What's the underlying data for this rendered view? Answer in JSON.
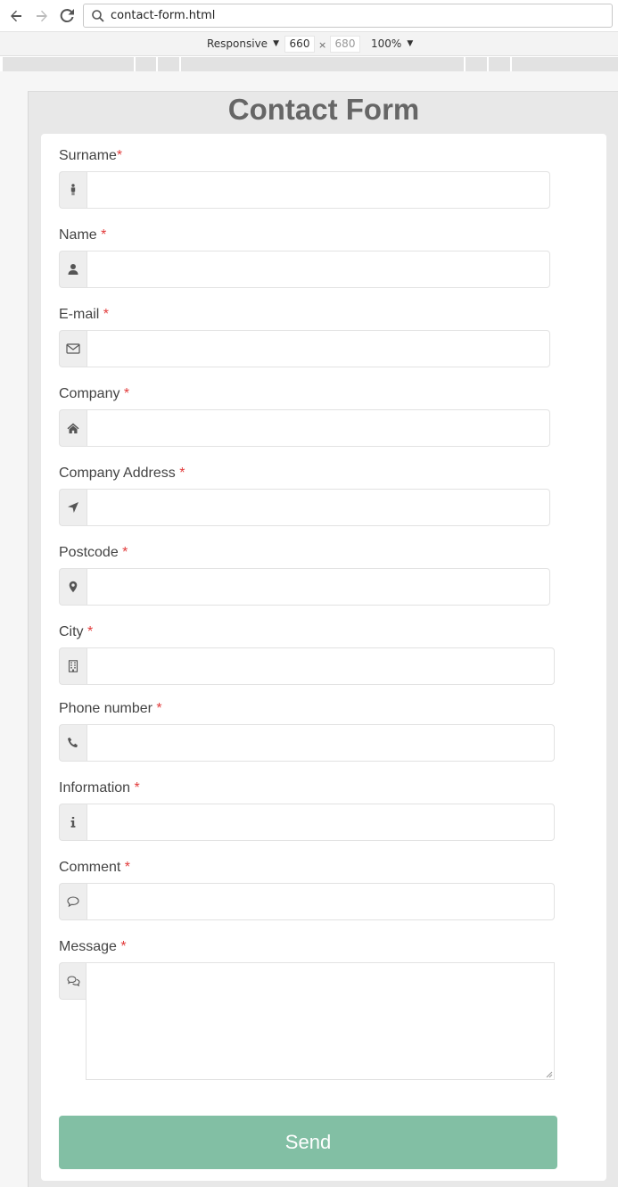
{
  "browser": {
    "url": "contact-form.html"
  },
  "devtools": {
    "mode": "Responsive",
    "width": "660",
    "times": "×",
    "height": "680",
    "zoom": "100%"
  },
  "form": {
    "title": "Contact Form",
    "fields": [
      {
        "label": "Surname",
        "required": "*",
        "icon": "male-icon",
        "value": ""
      },
      {
        "label": "Name ",
        "required": "*",
        "icon": "user-icon",
        "value": ""
      },
      {
        "label": "E-mail ",
        "required": "*",
        "icon": "envelope-icon",
        "value": ""
      },
      {
        "label": "Company ",
        "required": "*",
        "icon": "home-icon",
        "value": ""
      },
      {
        "label": "Company Address ",
        "required": "*",
        "icon": "location-arrow-icon",
        "value": ""
      },
      {
        "label": "Postcode ",
        "required": "*",
        "icon": "map-marker-icon",
        "value": ""
      },
      {
        "label": "City ",
        "required": "*",
        "icon": "building-icon",
        "value": ""
      },
      {
        "label": "Phone number ",
        "required": "*",
        "icon": "phone-icon",
        "value": ""
      },
      {
        "label": "Information ",
        "required": "*",
        "icon": "info-icon",
        "value": ""
      },
      {
        "label": "Comment ",
        "required": "*",
        "icon": "comment-icon",
        "value": ""
      }
    ],
    "message": {
      "label": "Message ",
      "required": "*",
      "icon": "comments-icon",
      "value": ""
    },
    "send_label": "Send"
  },
  "colors": {
    "send_button": "#82bfa4",
    "required_star": "#e23c3c",
    "frame_background": "#e8e8e8"
  }
}
